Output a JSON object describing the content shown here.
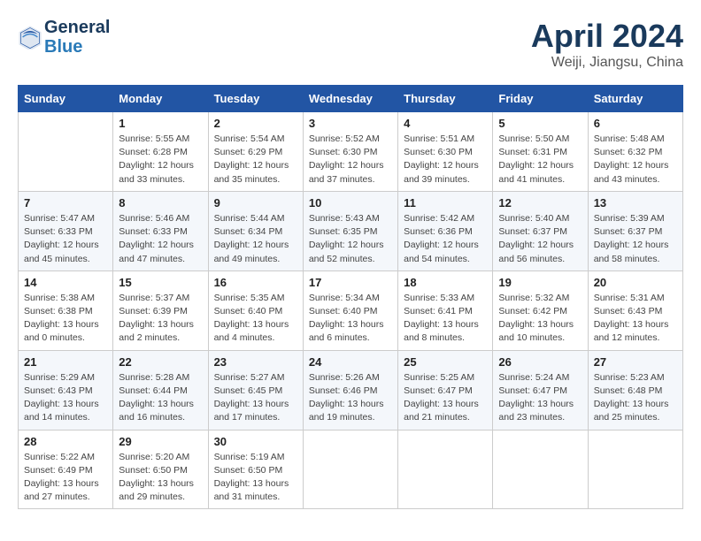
{
  "header": {
    "logo_line1": "General",
    "logo_line2": "Blue",
    "month_title": "April 2024",
    "location": "Weiji, Jiangsu, China"
  },
  "weekdays": [
    "Sunday",
    "Monday",
    "Tuesday",
    "Wednesday",
    "Thursday",
    "Friday",
    "Saturday"
  ],
  "weeks": [
    [
      null,
      {
        "day": 1,
        "sunrise": "5:55 AM",
        "sunset": "6:28 PM",
        "daylight": "12 hours and 33 minutes."
      },
      {
        "day": 2,
        "sunrise": "5:54 AM",
        "sunset": "6:29 PM",
        "daylight": "12 hours and 35 minutes."
      },
      {
        "day": 3,
        "sunrise": "5:52 AM",
        "sunset": "6:30 PM",
        "daylight": "12 hours and 37 minutes."
      },
      {
        "day": 4,
        "sunrise": "5:51 AM",
        "sunset": "6:30 PM",
        "daylight": "12 hours and 39 minutes."
      },
      {
        "day": 5,
        "sunrise": "5:50 AM",
        "sunset": "6:31 PM",
        "daylight": "12 hours and 41 minutes."
      },
      {
        "day": 6,
        "sunrise": "5:48 AM",
        "sunset": "6:32 PM",
        "daylight": "12 hours and 43 minutes."
      }
    ],
    [
      {
        "day": 7,
        "sunrise": "5:47 AM",
        "sunset": "6:33 PM",
        "daylight": "12 hours and 45 minutes."
      },
      {
        "day": 8,
        "sunrise": "5:46 AM",
        "sunset": "6:33 PM",
        "daylight": "12 hours and 47 minutes."
      },
      {
        "day": 9,
        "sunrise": "5:44 AM",
        "sunset": "6:34 PM",
        "daylight": "12 hours and 49 minutes."
      },
      {
        "day": 10,
        "sunrise": "5:43 AM",
        "sunset": "6:35 PM",
        "daylight": "12 hours and 52 minutes."
      },
      {
        "day": 11,
        "sunrise": "5:42 AM",
        "sunset": "6:36 PM",
        "daylight": "12 hours and 54 minutes."
      },
      {
        "day": 12,
        "sunrise": "5:40 AM",
        "sunset": "6:37 PM",
        "daylight": "12 hours and 56 minutes."
      },
      {
        "day": 13,
        "sunrise": "5:39 AM",
        "sunset": "6:37 PM",
        "daylight": "12 hours and 58 minutes."
      }
    ],
    [
      {
        "day": 14,
        "sunrise": "5:38 AM",
        "sunset": "6:38 PM",
        "daylight": "13 hours and 0 minutes."
      },
      {
        "day": 15,
        "sunrise": "5:37 AM",
        "sunset": "6:39 PM",
        "daylight": "13 hours and 2 minutes."
      },
      {
        "day": 16,
        "sunrise": "5:35 AM",
        "sunset": "6:40 PM",
        "daylight": "13 hours and 4 minutes."
      },
      {
        "day": 17,
        "sunrise": "5:34 AM",
        "sunset": "6:40 PM",
        "daylight": "13 hours and 6 minutes."
      },
      {
        "day": 18,
        "sunrise": "5:33 AM",
        "sunset": "6:41 PM",
        "daylight": "13 hours and 8 minutes."
      },
      {
        "day": 19,
        "sunrise": "5:32 AM",
        "sunset": "6:42 PM",
        "daylight": "13 hours and 10 minutes."
      },
      {
        "day": 20,
        "sunrise": "5:31 AM",
        "sunset": "6:43 PM",
        "daylight": "13 hours and 12 minutes."
      }
    ],
    [
      {
        "day": 21,
        "sunrise": "5:29 AM",
        "sunset": "6:43 PM",
        "daylight": "13 hours and 14 minutes."
      },
      {
        "day": 22,
        "sunrise": "5:28 AM",
        "sunset": "6:44 PM",
        "daylight": "13 hours and 16 minutes."
      },
      {
        "day": 23,
        "sunrise": "5:27 AM",
        "sunset": "6:45 PM",
        "daylight": "13 hours and 17 minutes."
      },
      {
        "day": 24,
        "sunrise": "5:26 AM",
        "sunset": "6:46 PM",
        "daylight": "13 hours and 19 minutes."
      },
      {
        "day": 25,
        "sunrise": "5:25 AM",
        "sunset": "6:47 PM",
        "daylight": "13 hours and 21 minutes."
      },
      {
        "day": 26,
        "sunrise": "5:24 AM",
        "sunset": "6:47 PM",
        "daylight": "13 hours and 23 minutes."
      },
      {
        "day": 27,
        "sunrise": "5:23 AM",
        "sunset": "6:48 PM",
        "daylight": "13 hours and 25 minutes."
      }
    ],
    [
      {
        "day": 28,
        "sunrise": "5:22 AM",
        "sunset": "6:49 PM",
        "daylight": "13 hours and 27 minutes."
      },
      {
        "day": 29,
        "sunrise": "5:20 AM",
        "sunset": "6:50 PM",
        "daylight": "13 hours and 29 minutes."
      },
      {
        "day": 30,
        "sunrise": "5:19 AM",
        "sunset": "6:50 PM",
        "daylight": "13 hours and 31 minutes."
      },
      null,
      null,
      null,
      null
    ]
  ]
}
